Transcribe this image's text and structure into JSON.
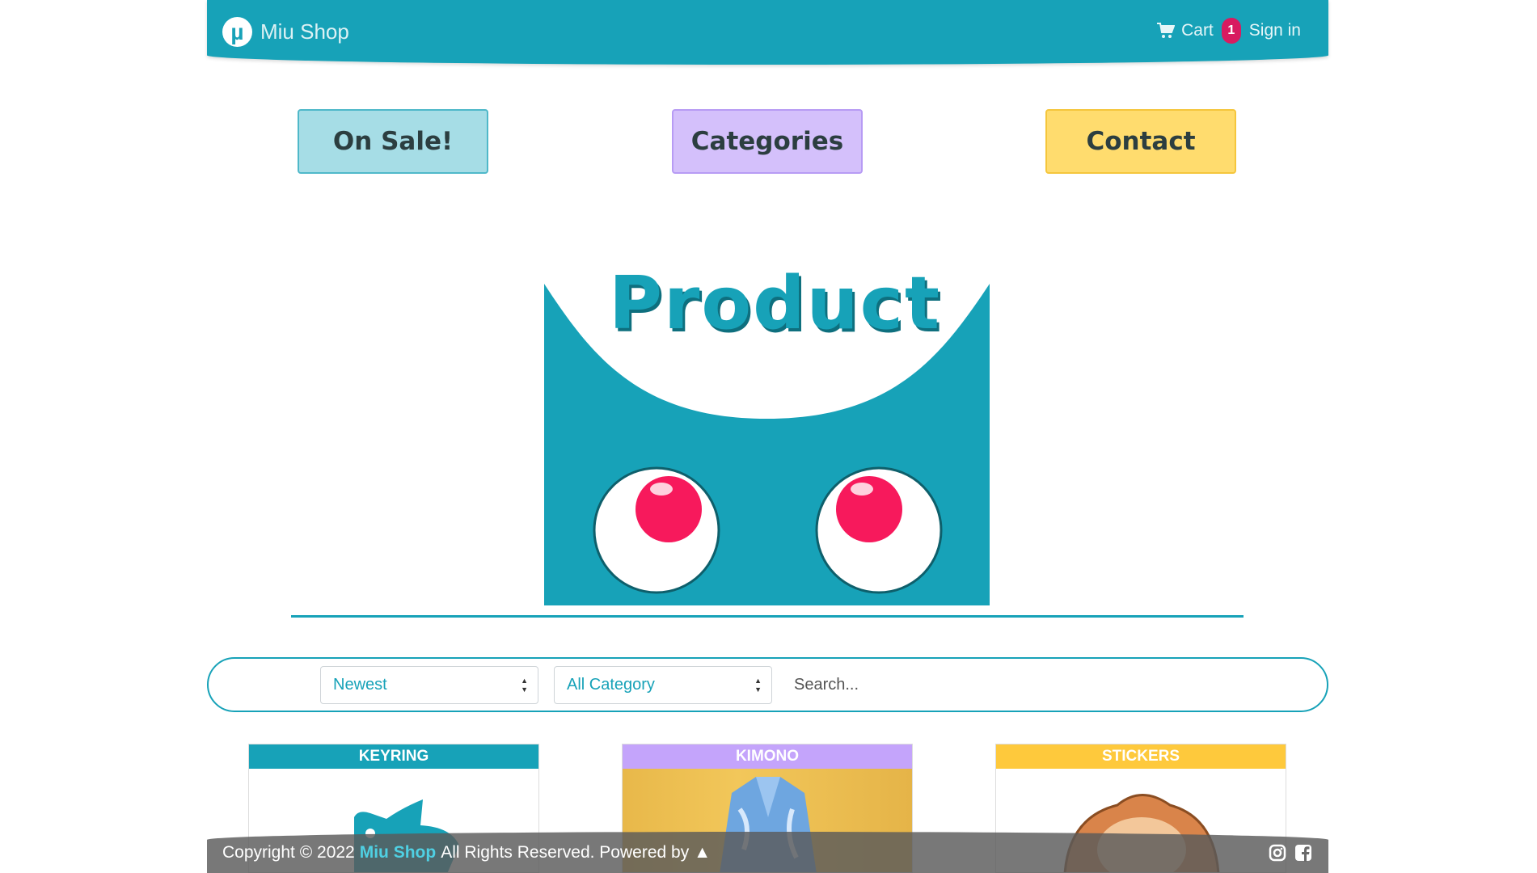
{
  "navbar": {
    "brand_logo": "µ",
    "brand_name": "Miu Shop",
    "cart_label": "Cart",
    "cart_count": "1",
    "signin_label": "Sign in",
    "icons": [
      "cart-icon"
    ]
  },
  "buttons": {
    "on_sale": "On Sale!",
    "categories": "Categories",
    "contact": "Contact"
  },
  "hero": {
    "title": "Product"
  },
  "filters": {
    "sort_value": "Newest",
    "category_value": "All Category",
    "search_placeholder": "Search..."
  },
  "products": [
    {
      "category": "KEYRING"
    },
    {
      "category": "KIMONO"
    },
    {
      "category": "STICKERS"
    }
  ],
  "footer": {
    "copyright": "Copyright © 2022",
    "brand": "Miu Shop",
    "rights": "All Rights Reserved. Powered by",
    "powered_icon": "▲",
    "icons": [
      "instagram-icon",
      "facebook-icon"
    ]
  },
  "colors": {
    "primary": "#17a2b8",
    "purple": "#c4a4fb",
    "yellow": "#fec93c",
    "badge": "#d81b60"
  }
}
